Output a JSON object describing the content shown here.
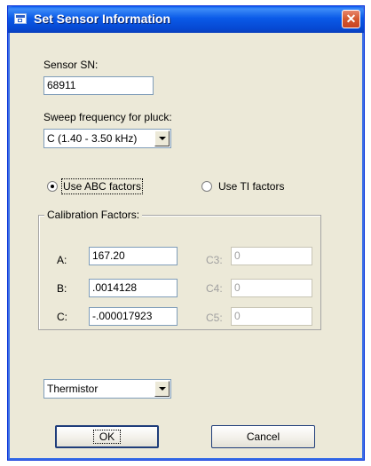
{
  "window": {
    "title": "Set Sensor Information",
    "close_glyph": "✕"
  },
  "sensor_sn": {
    "label": "Sensor SN:",
    "value": "68911"
  },
  "sweep": {
    "label": "Sweep frequency for pluck:",
    "selected": "C (1.40 - 3.50 kHz)"
  },
  "factor_mode": {
    "abc_label": "Use ABC factors",
    "ti_label": "Use TI factors",
    "selected": "abc"
  },
  "calibration": {
    "title": "Calibration Factors:",
    "a_label": "A:",
    "a_value": "167.20",
    "b_label": "B:",
    "b_value": ".0014128",
    "c_label": "C:",
    "c_value": "-.000017923",
    "c3_label": "C3:",
    "c3_value": "0",
    "c4_label": "C4:",
    "c4_value": "0",
    "c5_label": "C5:",
    "c5_value": "0"
  },
  "temp_sensor": {
    "selected": "Thermistor"
  },
  "buttons": {
    "ok_label": "OK",
    "cancel_label": "Cancel"
  },
  "icons": {
    "window": "window-app-icon",
    "close": "close-icon",
    "dropdown": "chevron-down-icon"
  },
  "colors": {
    "titlebar": "#0a5ae8",
    "close": "#d4582e",
    "dialog_bg": "#ece9d8",
    "disabled_text": "#a0a0a0"
  }
}
